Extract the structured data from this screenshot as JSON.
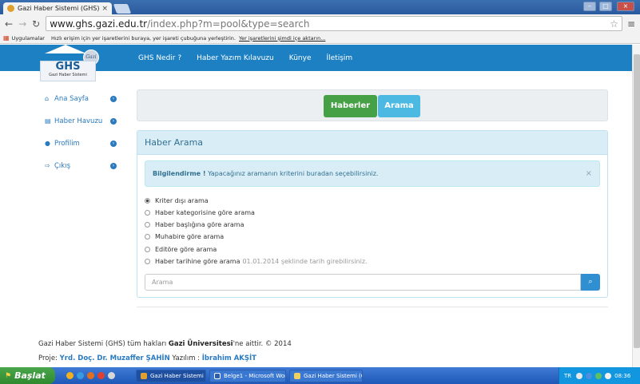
{
  "browser": {
    "tab_title": "Gazi Haber Sistemi (GHS)",
    "tab_close": "×",
    "url_host": "www.ghs.gazi.edu.tr",
    "url_path": "/index.php?m=pool&type=search",
    "bookmarks_apps": "Uygulamalar",
    "bookmarks_text": "Hızlı erişim için yer işaretlerini buraya, yer işareti çubuğuna yerleştirin.",
    "bookmarks_link": "Yer işaretlerini şimdi içe aktarın..."
  },
  "site": {
    "logo_text": "GHS",
    "logo_subtext": "Gazi Haber Sistemi",
    "logo_seal": "Gazi",
    "nav": [
      "GHS Nedir ?",
      "Haber Yazım Kılavuzu",
      "Künye",
      "İletişim"
    ]
  },
  "sidebar": {
    "items": [
      {
        "label": "Ana Sayfa",
        "icon": "home-icon",
        "glyph": "⌂"
      },
      {
        "label": "Haber Havuzu",
        "icon": "list-icon",
        "glyph": "▤"
      },
      {
        "label": "Profilim",
        "icon": "info-icon",
        "glyph": "●"
      },
      {
        "label": "Çıkış",
        "icon": "logout-icon",
        "glyph": "⇨"
      }
    ],
    "arrow": "›"
  },
  "tabs": {
    "news": "Haberler",
    "search": "Arama"
  },
  "panel": {
    "title": "Haber Arama",
    "alert_strong": "Bilgilendirme !",
    "alert_text": " Yapacağınız aramanın kriterini buradan seçebilirsiniz.",
    "alert_close": "×",
    "options": [
      {
        "label": "Kriter dışı arama",
        "checked": true,
        "hint": ""
      },
      {
        "label": "Haber kategorisine göre arama",
        "checked": false,
        "hint": ""
      },
      {
        "label": "Haber başlığına göre arama",
        "checked": false,
        "hint": ""
      },
      {
        "label": "Muhabire göre arama",
        "checked": false,
        "hint": ""
      },
      {
        "label": "Editöre göre arama",
        "checked": false,
        "hint": ""
      },
      {
        "label": "Haber tarihine göre arama",
        "checked": false,
        "hint": "01.01.2014 şeklinde tarih girebilirsiniz."
      }
    ],
    "search_placeholder": "Arama"
  },
  "footer": {
    "line1_a": "Gazi Haber Sistemi (GHS) tüm hakları ",
    "line1_b": "Gazi Üniversitesi",
    "line1_c": "'ne aittir. © 2014",
    "line2_a": "Proje: ",
    "line2_b": "Yrd. Doç. Dr. Muzaffer ŞAHİN",
    "line2_c": " Yazılım : ",
    "line2_d": "İbrahim AKŞİT"
  },
  "taskbar": {
    "start": "Başlat",
    "tasks": [
      "Gazi Haber Sistemi (G...",
      "Belge1 - Microsoft Word",
      "Gazi Haber Sistemi (G..."
    ],
    "lang": "TR",
    "time": "08:36"
  },
  "colors": {
    "navbar": "#1d80c3",
    "success": "#46a046",
    "info": "#4cb9e3",
    "panel_head": "#d9edf7"
  }
}
